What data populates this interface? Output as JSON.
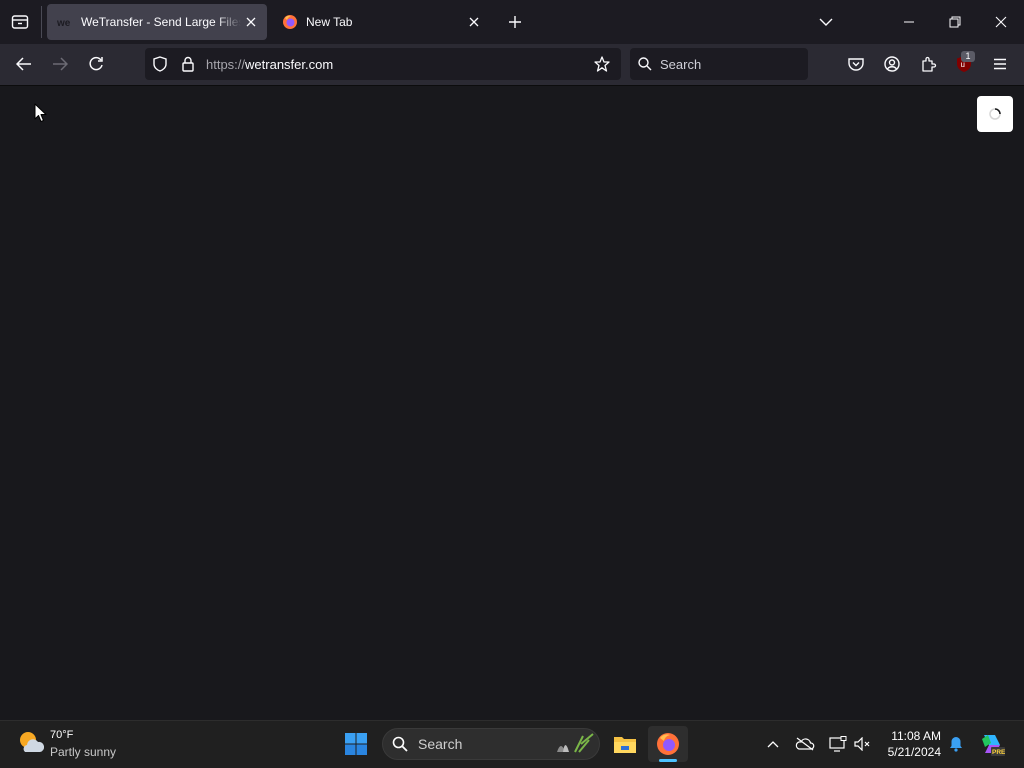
{
  "browser": {
    "tabs": [
      {
        "title": "WeTransfer - Send Large Files &",
        "active": true,
        "favicon": "wetransfer-favicon"
      },
      {
        "title": "New Tab",
        "active": false,
        "favicon": "firefox-logo"
      }
    ],
    "url": {
      "scheme": "https://",
      "host": "wetransfer.com"
    },
    "search_placeholder": "Search",
    "extension_badge": "1"
  },
  "taskbar": {
    "weather": {
      "temp": "70°F",
      "desc": "Partly sunny"
    },
    "search_placeholder": "Search",
    "clock": {
      "time": "11:08 AM",
      "date": "5/21/2024"
    }
  },
  "colors": {
    "tabstrip": "#1c1b22",
    "navbar": "#2b2a33",
    "content": "#18181c",
    "taskbar": "#202020",
    "accent": "#4cc2ff"
  }
}
